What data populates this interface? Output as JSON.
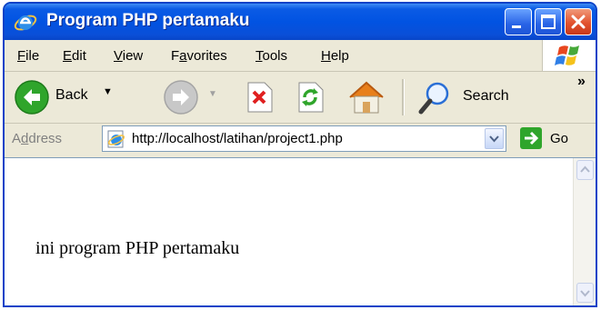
{
  "window": {
    "title": "Program PHP pertamaku"
  },
  "menubar": {
    "items": [
      {
        "acc": "F",
        "rest": "ile"
      },
      {
        "acc": "E",
        "rest": "dit"
      },
      {
        "acc": "V",
        "rest": "iew"
      },
      {
        "pre": "F",
        "acc": "a",
        "rest": "vorites"
      },
      {
        "acc": "T",
        "rest": "ools"
      },
      {
        "acc": "H",
        "rest": "elp"
      }
    ]
  },
  "toolbar": {
    "back_label": "Back",
    "search_label": "Search",
    "overflow": "»"
  },
  "addressbar": {
    "label_pre": "A",
    "label_acc": "d",
    "label_rest": "dress",
    "url": "http://localhost/latihan/project1.php",
    "go_label": "Go"
  },
  "page": {
    "text": "ini program PHP pertamaku"
  },
  "colors": {
    "titlebar": "#0153e2",
    "chrome": "#ece9d8",
    "close": "#e2532f",
    "back_green": "#2fa52b"
  }
}
